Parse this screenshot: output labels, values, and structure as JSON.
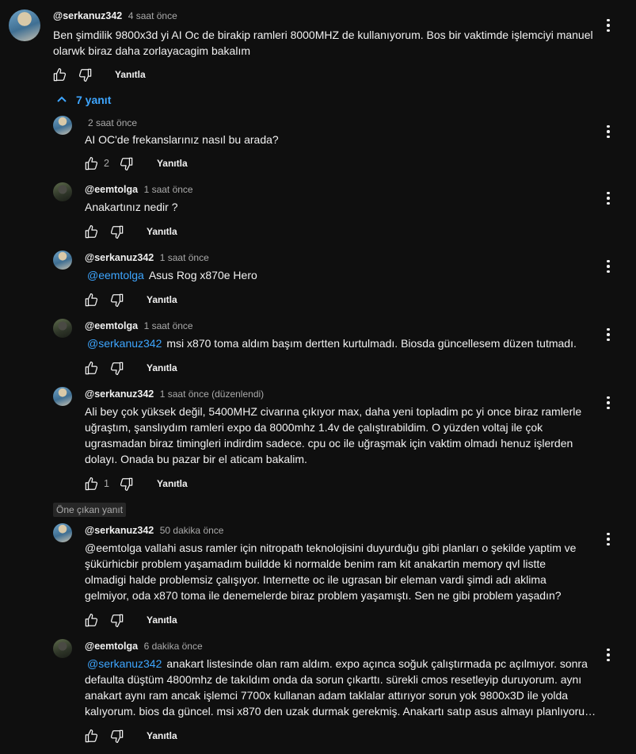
{
  "top_comment": {
    "handle": "@serkanuz342",
    "time": "4 saat önce",
    "lines": [
      "Ben şimdilik 9800x3d yi AI Oc de birakip ramleri 8000MHZ de kullanıyorum. Bos bir vaktimde işlemciyi manuel",
      "olarwk biraz daha zorlayacagim bakalım"
    ],
    "reply_label": "Yanıtla"
  },
  "replies_toggle": "7 yanıt",
  "pinned_badge": "Öne çıkan yanıt",
  "replies": [
    {
      "handle": "",
      "time": "2 saat önce",
      "mention": "",
      "lines": [
        "AI OC'de frekanslarınız nasıl bu arada?"
      ],
      "likes": "2",
      "reply_label": "Yanıtla",
      "avatar": "serkan"
    },
    {
      "handle": "@eemtolga",
      "time": "1 saat önce",
      "mention": "",
      "lines": [
        "Anakartınız nedir ?"
      ],
      "likes": "",
      "reply_label": "Yanıtla",
      "avatar": "eem"
    },
    {
      "handle": "@serkanuz342",
      "time": "1 saat önce",
      "mention": "@eemtolga",
      "lines": [
        "Asus Rog x870e Hero"
      ],
      "likes": "",
      "reply_label": "Yanıtla",
      "avatar": "serkan"
    },
    {
      "handle": "@eemtolga",
      "time": "1 saat önce",
      "mention": "@serkanuz342",
      "lines": [
        "msi x870 toma aldım başım dertten kurtulmadı. Biosda güncellesem düzen tutmadı."
      ],
      "likes": "",
      "reply_label": "Yanıtla",
      "avatar": "eem"
    },
    {
      "handle": "@serkanuz342",
      "time": "1 saat önce (düzenlendi)",
      "mention": "",
      "lines": [
        "Ali bey çok yüksek değil, 5400MHZ civarına çıkıyor max, daha yeni topladim pc yi once biraz ramlerle",
        "uğraştım, şanslıydım ramleri expo da 8000mhz 1.4v de çalıştırabildim. O yüzden voltaj ile çok",
        "ugrasmadan biraz timingleri indirdim sadece. cpu oc ile uğraşmak için vaktim olmadı henuz işlerden",
        "dolayı.  Onada bu pazar bir el aticam bakalim."
      ],
      "likes": "1",
      "reply_label": "Yanıtla",
      "avatar": "serkan"
    },
    {
      "handle": "@serkanuz342",
      "time": "50 dakika önce",
      "mention": "",
      "lines": [
        "@eemtolga  vallahi asus ramler için nitropath teknolojisini duyurduğu gibi planları o şekilde yaptim ve",
        "şükürhicbir problem yaşamadım buildde ki normalde benim ram kit anakartin memory qvl listte",
        "olmadigi halde problemsiz çalışıyor. Internette oc ile ugrasan bir eleman vardi şimdi adı aklima",
        "gelmiyor, oda x870 toma ile  denemelerde biraz problem yaşamıştı. Sen ne gibi problem yaşadın?"
      ],
      "likes": "",
      "reply_label": "Yanıtla",
      "avatar": "serkan"
    },
    {
      "handle": "@eemtolga",
      "time": "6 dakika önce",
      "mention": "@serkanuz342",
      "lines": [
        "anakart listesinde olan ram aldım. expo açınca soğuk çalıştırmada pc açılmıyor. sonra",
        "defaulta düştüm 4800mhz de takıldım onda da sorun çıkarttı. sürekli cmos resetleyip duruyorum. aynı",
        "anakart aynı ram ancak işlemci 7700x kullanan adam taklalar attırıyor sorun yok 9800x3D ile yolda",
        "kalıyorum. bios da güncel. msi x870 den uzak durmak gerekmiş. Anakartı satıp asus almayı planlıyoru…"
      ],
      "likes": "",
      "reply_label": "Yanıtla",
      "avatar": "eem"
    }
  ],
  "icons": [
    "like-icon",
    "dislike-icon",
    "more-vert-icon",
    "chevron-up-icon"
  ],
  "colors": {
    "background": "#0f0f0f",
    "text": "#f1f1f1",
    "secondary": "#aaaaaa",
    "link": "#3ea6ff"
  }
}
